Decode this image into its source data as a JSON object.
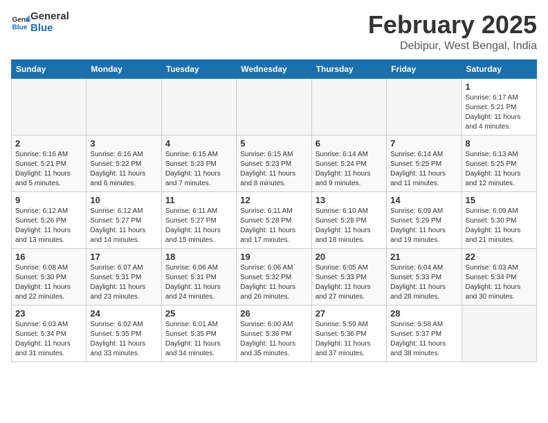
{
  "header": {
    "logo_line1": "General",
    "logo_line2": "Blue",
    "month": "February 2025",
    "location": "Debipur, West Bengal, India"
  },
  "weekdays": [
    "Sunday",
    "Monday",
    "Tuesday",
    "Wednesday",
    "Thursday",
    "Friday",
    "Saturday"
  ],
  "weeks": [
    [
      {
        "day": "",
        "info": ""
      },
      {
        "day": "",
        "info": ""
      },
      {
        "day": "",
        "info": ""
      },
      {
        "day": "",
        "info": ""
      },
      {
        "day": "",
        "info": ""
      },
      {
        "day": "",
        "info": ""
      },
      {
        "day": "1",
        "info": "Sunrise: 6:17 AM\nSunset: 5:21 PM\nDaylight: 11 hours\nand 4 minutes."
      }
    ],
    [
      {
        "day": "2",
        "info": "Sunrise: 6:16 AM\nSunset: 5:21 PM\nDaylight: 11 hours\nand 5 minutes."
      },
      {
        "day": "3",
        "info": "Sunrise: 6:16 AM\nSunset: 5:22 PM\nDaylight: 11 hours\nand 6 minutes."
      },
      {
        "day": "4",
        "info": "Sunrise: 6:15 AM\nSunset: 5:23 PM\nDaylight: 11 hours\nand 7 minutes."
      },
      {
        "day": "5",
        "info": "Sunrise: 6:15 AM\nSunset: 5:23 PM\nDaylight: 11 hours\nand 8 minutes."
      },
      {
        "day": "6",
        "info": "Sunrise: 6:14 AM\nSunset: 5:24 PM\nDaylight: 11 hours\nand 9 minutes."
      },
      {
        "day": "7",
        "info": "Sunrise: 6:14 AM\nSunset: 5:25 PM\nDaylight: 11 hours\nand 11 minutes."
      },
      {
        "day": "8",
        "info": "Sunrise: 6:13 AM\nSunset: 5:25 PM\nDaylight: 11 hours\nand 12 minutes."
      }
    ],
    [
      {
        "day": "9",
        "info": "Sunrise: 6:12 AM\nSunset: 5:26 PM\nDaylight: 11 hours\nand 13 minutes."
      },
      {
        "day": "10",
        "info": "Sunrise: 6:12 AM\nSunset: 5:27 PM\nDaylight: 11 hours\nand 14 minutes."
      },
      {
        "day": "11",
        "info": "Sunrise: 6:11 AM\nSunset: 5:27 PM\nDaylight: 11 hours\nand 15 minutes."
      },
      {
        "day": "12",
        "info": "Sunrise: 6:11 AM\nSunset: 5:28 PM\nDaylight: 11 hours\nand 17 minutes."
      },
      {
        "day": "13",
        "info": "Sunrise: 6:10 AM\nSunset: 5:28 PM\nDaylight: 11 hours\nand 18 minutes."
      },
      {
        "day": "14",
        "info": "Sunrise: 6:09 AM\nSunset: 5:29 PM\nDaylight: 11 hours\nand 19 minutes."
      },
      {
        "day": "15",
        "info": "Sunrise: 6:09 AM\nSunset: 5:30 PM\nDaylight: 11 hours\nand 21 minutes."
      }
    ],
    [
      {
        "day": "16",
        "info": "Sunrise: 6:08 AM\nSunset: 5:30 PM\nDaylight: 11 hours\nand 22 minutes."
      },
      {
        "day": "17",
        "info": "Sunrise: 6:07 AM\nSunset: 5:31 PM\nDaylight: 11 hours\nand 23 minutes."
      },
      {
        "day": "18",
        "info": "Sunrise: 6:06 AM\nSunset: 5:31 PM\nDaylight: 11 hours\nand 24 minutes."
      },
      {
        "day": "19",
        "info": "Sunrise: 6:06 AM\nSunset: 5:32 PM\nDaylight: 11 hours\nand 26 minutes."
      },
      {
        "day": "20",
        "info": "Sunrise: 6:05 AM\nSunset: 5:33 PM\nDaylight: 11 hours\nand 27 minutes."
      },
      {
        "day": "21",
        "info": "Sunrise: 6:04 AM\nSunset: 5:33 PM\nDaylight: 11 hours\nand 28 minutes."
      },
      {
        "day": "22",
        "info": "Sunrise: 6:03 AM\nSunset: 5:34 PM\nDaylight: 11 hours\nand 30 minutes."
      }
    ],
    [
      {
        "day": "23",
        "info": "Sunrise: 6:03 AM\nSunset: 5:34 PM\nDaylight: 11 hours\nand 31 minutes."
      },
      {
        "day": "24",
        "info": "Sunrise: 6:02 AM\nSunset: 5:35 PM\nDaylight: 11 hours\nand 33 minutes."
      },
      {
        "day": "25",
        "info": "Sunrise: 6:01 AM\nSunset: 5:35 PM\nDaylight: 11 hours\nand 34 minutes."
      },
      {
        "day": "26",
        "info": "Sunrise: 6:00 AM\nSunset: 5:36 PM\nDaylight: 11 hours\nand 35 minutes."
      },
      {
        "day": "27",
        "info": "Sunrise: 5:59 AM\nSunset: 5:36 PM\nDaylight: 11 hours\nand 37 minutes."
      },
      {
        "day": "28",
        "info": "Sunrise: 5:58 AM\nSunset: 5:37 PM\nDaylight: 11 hours\nand 38 minutes."
      },
      {
        "day": "",
        "info": ""
      }
    ]
  ]
}
